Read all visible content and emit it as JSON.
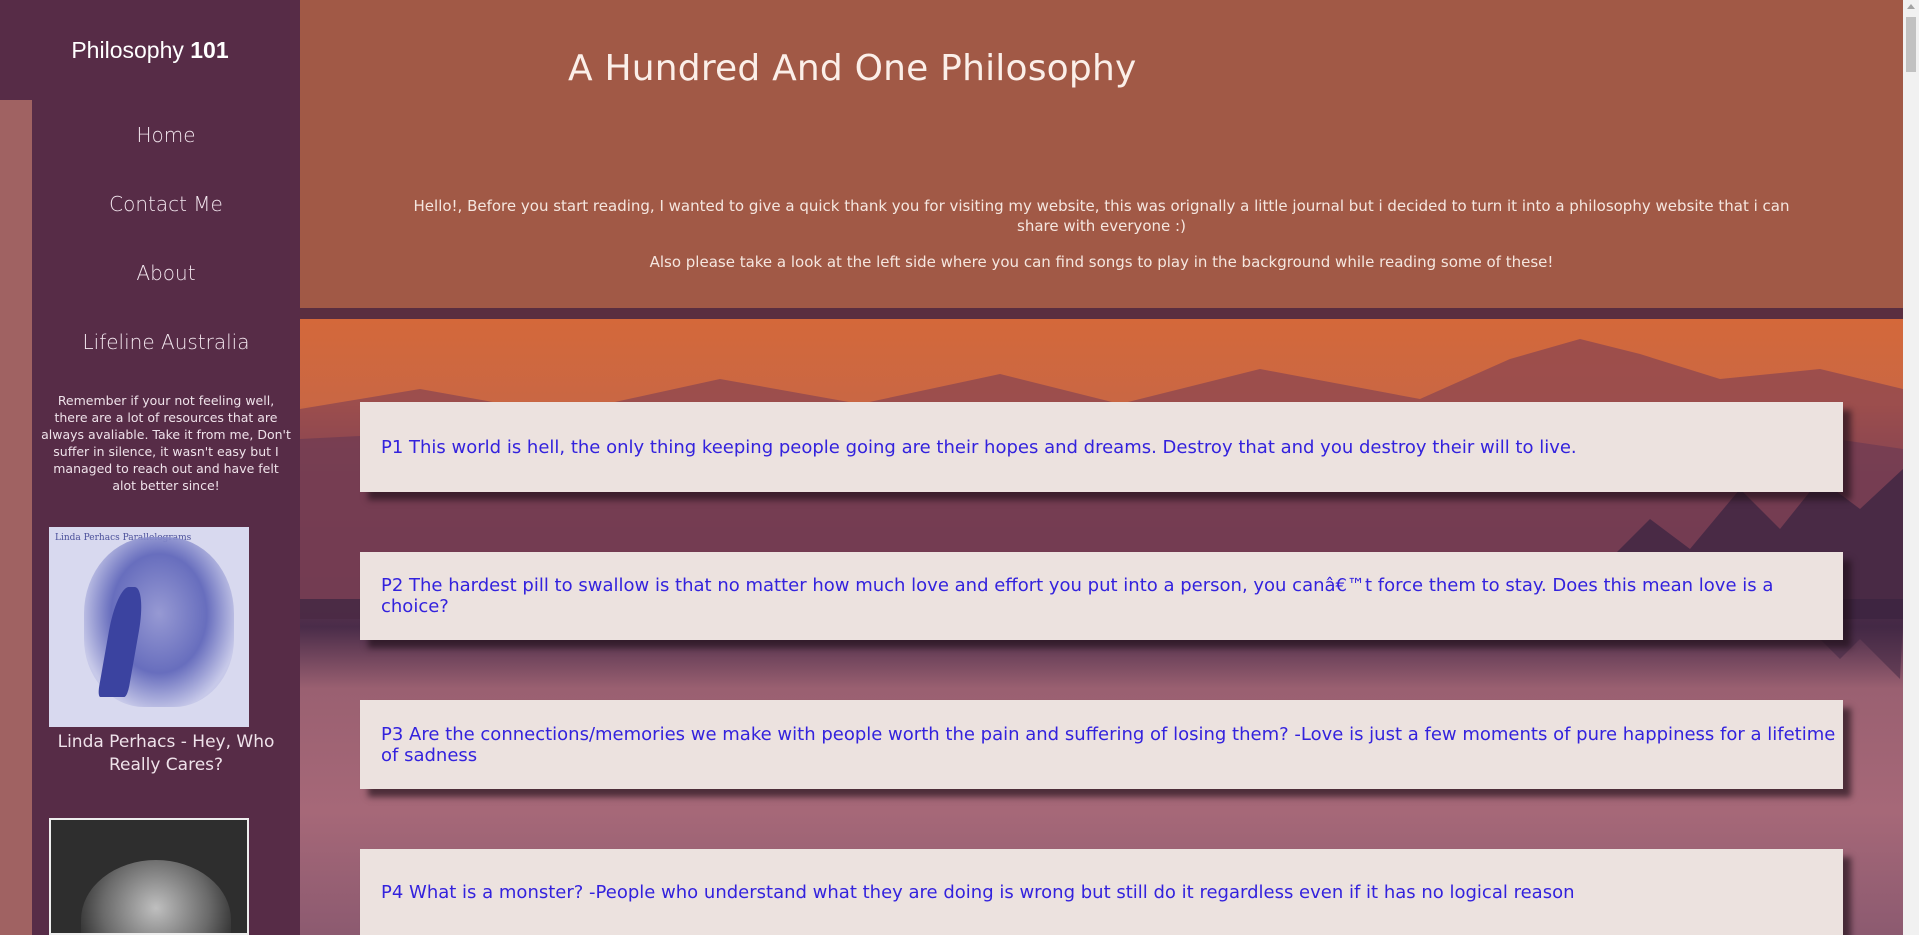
{
  "brand": {
    "name": "Philosophy ",
    "number": "101"
  },
  "nav": {
    "items": [
      {
        "label": "Home"
      },
      {
        "label": "Contact Me"
      },
      {
        "label": "About"
      },
      {
        "label": "Lifeline Australia"
      }
    ]
  },
  "sidebar_note": "Remember if your not feeling well, there are a lot of resources that are always avaliable. Take it from me, Don't suffer in silence, it wasn't easy but I managed to reach out and have felt alot better since!",
  "albums": [
    {
      "cover_text": "Linda Perhacs Parallelograms",
      "caption": "Linda Perhacs - Hey, Who Really Cares?"
    },
    {
      "cover_text": ""
    }
  ],
  "header": {
    "title": "A Hundred And One Philosophy",
    "intro_1": "Hello!, Before you start reading, I wanted to give a quick thank you for visiting my website, this was orignally a little journal but i decided to turn it into a philosophy website that i can share with everyone :)",
    "intro_2": "Also please take a look at the left side where you can find songs to play in the background while reading some of these!"
  },
  "posts": [
    {
      "text": "P1 This world is hell, the only thing keeping people going are their hopes and dreams. Destroy that and you destroy their will to live."
    },
    {
      "text": "P2 The hardest pill to swallow is that no matter how much love and effort you put into a person, you canâ€™t force them to stay. Does this mean love is a choice?"
    },
    {
      "text": "P3 Are the connections/memories we make with people worth the pain and suffering of losing them? -Love is just a few moments of pure happiness for a lifetime of sadness"
    },
    {
      "text": "P4 What is a monster? -People who understand what they are doing is wrong but still do it regardless even if it has no logical reason"
    }
  ],
  "colors": {
    "sidebar": "#572c47",
    "header": "#a15946",
    "card": "#ece2df",
    "card_text": "#3322dd"
  }
}
